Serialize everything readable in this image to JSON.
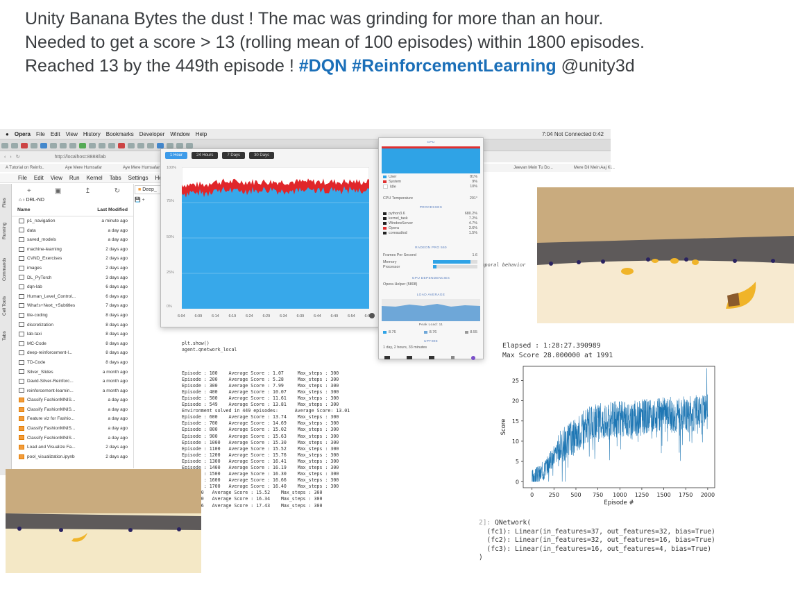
{
  "tweet": {
    "line1": "Unity Banana Bytes the dust ! The mac was grinding for more than an hour.",
    "line2": "Needed to get a score > 13 (rolling mean of 100 episodes) within 1800 episodes.",
    "line3_prefix": "Reached 13 by the 449th episode !",
    "hashtag1": "#DQN",
    "hashtag2": "#ReinforcementLearning",
    "mention": "@unity3d"
  },
  "menubar": {
    "items": [
      "Opera",
      "File",
      "Edit",
      "View",
      "History",
      "Bookmarks",
      "Developer",
      "Window",
      "Help"
    ],
    "right": "7:04   Not Connected   0:42"
  },
  "urlbar": {
    "url": "http://localhost:8888/lab"
  },
  "bookmarks": [
    "A Tutorial on Reinfo..",
    "Aye Mere Humsafar",
    "Aye Mere Humsafar",
    "Jeevan Mein Tu Do...",
    "Mere Dil Mein Aaj Ki..."
  ],
  "jupyter_menu": [
    "File",
    "Edit",
    "View",
    "Run",
    "Kernel",
    "Tabs",
    "Settings",
    "Help"
  ],
  "rail": [
    "Files",
    "Running",
    "Commands",
    "Cell Tools",
    "Tabs"
  ],
  "files": {
    "breadcrumb": "DRL-ND",
    "col_name": "Name",
    "col_modified": "Last Modified",
    "rows": [
      {
        "name": "p1_navigation",
        "mod": "a minute ago",
        "nb": false
      },
      {
        "name": "data",
        "mod": "a day ago",
        "nb": false
      },
      {
        "name": "saved_models",
        "mod": "a day ago",
        "nb": false
      },
      {
        "name": "machine-learning",
        "mod": "2 days ago",
        "nb": false
      },
      {
        "name": "CVND_Exercises",
        "mod": "2 days ago",
        "nb": false
      },
      {
        "name": "images",
        "mod": "2 days ago",
        "nb": false
      },
      {
        "name": "DL_PyTorch",
        "mod": "3 days ago",
        "nb": false
      },
      {
        "name": "dqn-lab",
        "mod": "6 days ago",
        "nb": false
      },
      {
        "name": "Human_Level_Control...",
        "mod": "6 days ago",
        "nb": false
      },
      {
        "name": "What's+Next_+Subtitles",
        "mod": "7 days ago",
        "nb": false
      },
      {
        "name": "tile-coding",
        "mod": "8 days ago",
        "nb": false
      },
      {
        "name": "discretization",
        "mod": "8 days ago",
        "nb": false
      },
      {
        "name": "lab-taxi",
        "mod": "8 days ago",
        "nb": false
      },
      {
        "name": "MC-Code",
        "mod": "8 days ago",
        "nb": false
      },
      {
        "name": "deep-reinforcement-l...",
        "mod": "8 days ago",
        "nb": false
      },
      {
        "name": "TD-Code",
        "mod": "8 days ago",
        "nb": false
      },
      {
        "name": "Silver_Slides",
        "mod": "a month ago",
        "nb": false
      },
      {
        "name": "David-Silver-Reinforc...",
        "mod": "a month ago",
        "nb": false
      },
      {
        "name": "reinforcement-learnin...",
        "mod": "a month ago",
        "nb": false
      },
      {
        "name": "Classify FashionMNIS...",
        "mod": "a day ago",
        "nb": true
      },
      {
        "name": "Classify FashionMNIS...",
        "mod": "a day ago",
        "nb": true
      },
      {
        "name": "Feature viz for Fashio...",
        "mod": "a day ago",
        "nb": true
      },
      {
        "name": "Classify FashionMNIS...",
        "mod": "a day ago",
        "nb": true
      },
      {
        "name": "Classify FashionMNIS...",
        "mod": "a day ago",
        "nb": true
      },
      {
        "name": "Load and Visualize Fa...",
        "mod": "2 days ago",
        "nb": true
      },
      {
        "name": "pool_visualization.ipynb",
        "mod": "2 days ago",
        "nb": true
      }
    ]
  },
  "notebook_tab": "Deep_",
  "activity": {
    "tabs": [
      "1 Hour",
      "24 Hours",
      "7 Days",
      "30 Days"
    ],
    "y_labels": [
      "100%",
      "75%",
      "50%",
      "25%",
      "0%"
    ],
    "x_labels": [
      "6:04",
      "6:09",
      "6:14",
      "6:19",
      "6:24",
      "6:29",
      "6:34",
      "6:39",
      "6:44",
      "6:49",
      "6:54",
      "6:59"
    ]
  },
  "stats": {
    "cpu_title": "CPU",
    "cpu_rows": [
      {
        "k": "User",
        "v": "81%",
        "c": "#2fa3e6"
      },
      {
        "k": "System",
        "v": "9%",
        "c": "#e03030"
      },
      {
        "k": "Idle",
        "v": "10%",
        "c": "#ffffff"
      }
    ],
    "temp_k": "CPU Temperature",
    "temp_v": "201°",
    "proc_title": "PROCESSES",
    "procs": [
      {
        "k": "python3.6",
        "v": "680.2%"
      },
      {
        "k": "kernel_task",
        "v": "7.2%"
      },
      {
        "k": "WindowServer",
        "v": "4.7%"
      },
      {
        "k": "Opera",
        "v": "3.6%"
      },
      {
        "k": "coreaudiod",
        "v": "1.5%"
      }
    ],
    "gpu_title": "RADEON PRO 560",
    "fps_k": "Frames Per Second",
    "fps_v": "1.6",
    "mem_k": "Memory",
    "procr_k": "Processor",
    "dep_title": "GPU DEPENDENCIES",
    "dep_v": "Opera Helper (5808)",
    "load_title": "LOAD AVERAGE",
    "peak": "Peak Load: 11",
    "loads": [
      "8.76",
      "8.76",
      "8.55"
    ],
    "uptime_title": "UPTIME",
    "uptime": "1 day, 2 hours, 33 minutes"
  },
  "code": {
    "pre": "plt.show()\nagent.qnetwork_local",
    "lines": [
      "Episode : 100    Average Score : 1.07     Max_steps : 300",
      "Episode : 200    Average Score : 5.28     Max_steps : 300",
      "Episode : 300    Average Score : 7.99     Max_steps : 300",
      "Episode : 400    Average Score : 10.07    Max_steps : 300",
      "Episode : 500    Average Score : 11.61    Max_steps : 300",
      "Episode : 549    Average Score : 13.81    Max_steps : 300",
      "Environment solved in 449 episodes:      Average Score: 13.01",
      "Episode : 600    Average Score : 13.74    Max_steps : 300",
      "Episode : 700    Average Score : 14.69    Max_steps : 300",
      "Episode : 800    Average Score : 15.02    Max_steps : 300",
      "Episode : 900    Average Score : 15.63    Max_steps : 300",
      "Episode : 1000   Average Score : 15.30    Max_steps : 300",
      "Episode : 1100   Average Score : 15.52    Max_steps : 300",
      "Episode : 1200   Average Score : 15.76    Max_steps : 300",
      "Episode : 1300   Average Score : 16.41    Max_steps : 300",
      "Episode : 1400   Average Score : 16.19    Max_steps : 300",
      "Episode : 1500   Average Score : 16.30    Max_steps : 300",
      "Episode : 1600   Average Score : 16.66    Max_steps : 300",
      "Episode : 1700   Average Score : 16.40    Max_steps : 300",
      "e : 1800   Average Score : 15.52    Max_steps : 300",
      "e : 1900   Average Score : 16.34    Max_steps : 300",
      "e : 1966   Average Score : 17.43    Max_steps : 300"
    ]
  },
  "temporal": "emporal behavior",
  "elapsed": "Elapsed : 1:28:27.390989\nMax Score 28.000000 at 1991",
  "qnetwork": {
    "prompt": "2]:",
    "text": "QNetwork(\n  (fc1): Linear(in_features=37, out_features=32, bias=True)\n  (fc2): Linear(in_features=32, out_features=16, bias=True)\n  (fc3): Linear(in_features=16, out_features=4, bias=True)\n)"
  },
  "chart_data": {
    "type": "line",
    "xlabel": "Episode #",
    "ylabel": "Score",
    "xlim": [
      -100,
      2080
    ],
    "ylim": [
      -1.5,
      28.5
    ],
    "xticks": [
      0,
      250,
      500,
      750,
      1000,
      1250,
      1500,
      1750,
      2000
    ],
    "yticks": [
      0,
      5,
      10,
      15,
      20,
      25
    ],
    "color": "#1f77b4",
    "trend": {
      "x": [
        0,
        100,
        200,
        300,
        400,
        500,
        600,
        700,
        800,
        1000,
        1200,
        1400,
        1600,
        1800,
        2000
      ],
      "y": [
        0.5,
        2,
        5,
        8,
        10,
        11.5,
        13.5,
        14.5,
        15,
        15.5,
        15.8,
        16.2,
        16.5,
        16.8,
        17.2
      ]
    },
    "max_score": 28,
    "max_at": 1991
  }
}
